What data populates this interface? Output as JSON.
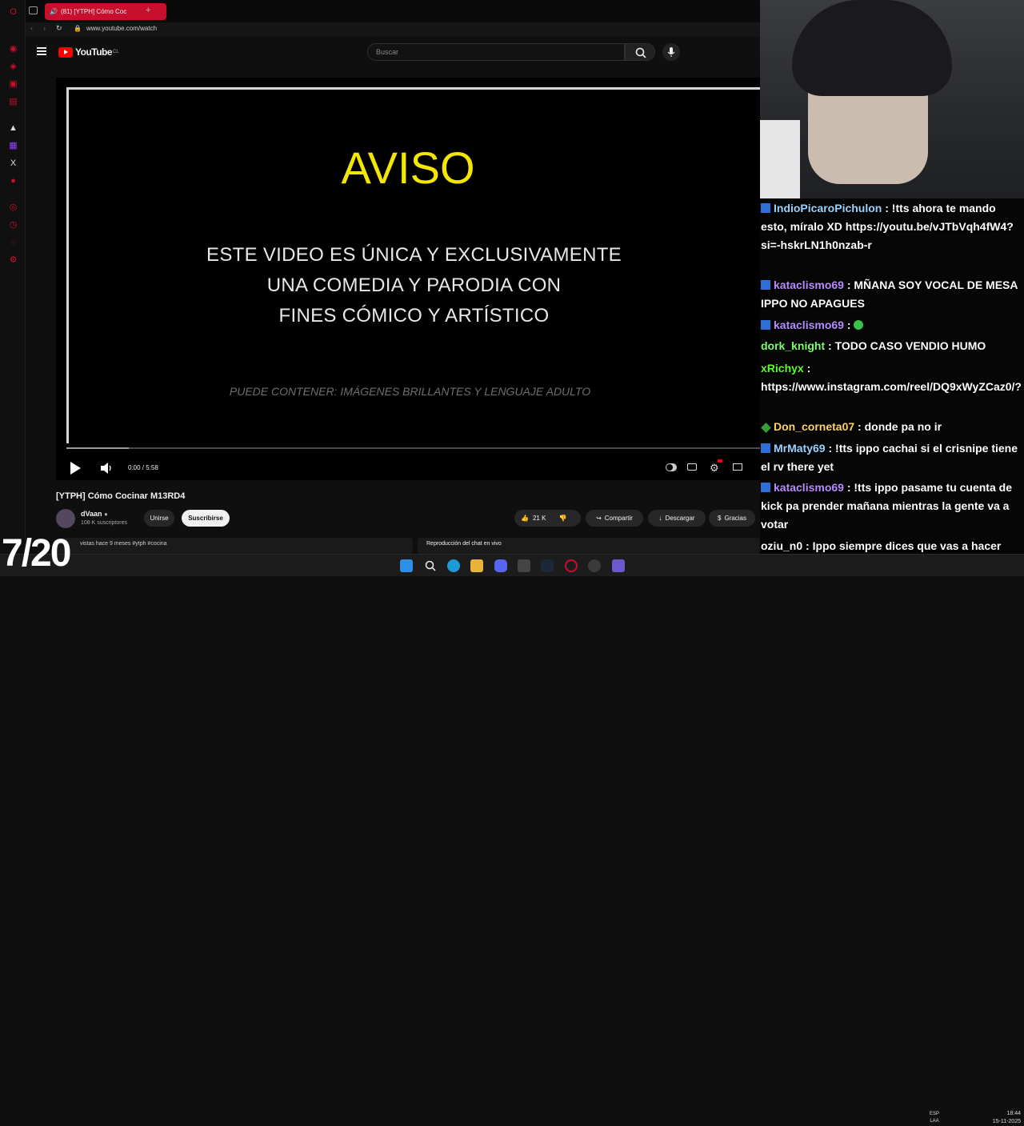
{
  "browser": {
    "tab_title": "(81) [YTPH] Cómo Coc",
    "url": "www.youtube.com/watch"
  },
  "youtube": {
    "logo_text": "YouTube",
    "logo_country": "CL",
    "search_placeholder": "Buscar"
  },
  "video": {
    "heading": "AVISO",
    "line1": "ESTE VIDEO ES ÚNICA Y EXCLUSIVAMENTE",
    "line2": "UNA COMEDIA Y PARODIA  CON",
    "line3": "FINES CÓMICO Y ARTÍSTICO",
    "subline": "PUEDE CONTENER: IMÁGENES BRILLANTES Y LENGUAJE ADULTO",
    "time": "0:00 / 5:58",
    "progress": 0.0
  },
  "meta": {
    "title": "[YTPH] Cómo Cocinar M13RD4",
    "channel": "dVaan",
    "subscribers": "108 K suscriptores",
    "join_label": "Unirse",
    "subscribe_label": "Suscribirse",
    "likes": "21 K",
    "share_label": "Compartir",
    "download_label": "Descargar",
    "thanks_label": "Gracias",
    "description": "vistas  hace 9 meses  #ytph #cocina",
    "chat_replay_label": "Reproducción del chat en vivo"
  },
  "chat": [
    {
      "user": "IndioPicaroPichulon",
      "color": "#9bd3ff",
      "text": " : !tts ahora te mando esto, míralo XD https://youtu.be/vJTbVqh4fW4?si=-hskrLN1h0nzab-r",
      "badge": "blue"
    },
    {
      "user": "kataclismo69",
      "color": "#b88cff",
      "text": " : MÑANA SOY VOCAL DE MESA IPPO NO APAGUES",
      "badge": "blue"
    },
    {
      "user": "kataclismo69",
      "color": "#b88cff",
      "text": " : ",
      "badge": "blue"
    },
    {
      "user": "dork_knight",
      "color": "#7dff6a",
      "text": " : TODO CASO VENDIO HUMO",
      "badge": ""
    },
    {
      "user": "xRichyx",
      "color": "#5cff2a",
      "text": " : https://www.instagram.com/reel/DQ9xWyZCaz0/?",
      "badge": ""
    },
    {
      "user": "Don_corneta07",
      "color": "#ffd36b",
      "text": " : donde pa no ir",
      "badge": "green"
    },
    {
      "user": "MrMaty69",
      "color": "#9bd3ff",
      "text": " : !tts ippo cachai si el crisnipe tiene el rv there yet",
      "badge": "blue"
    },
    {
      "user": "kataclismo69",
      "color": "#b88cff",
      "text": " : !tts ippo pasame tu cuenta de kick pa prender mañana mientras la gente va a votar",
      "badge": "blue"
    },
    {
      "user": "oziu_n0",
      "color": "#ffffff",
      "text": " : Ippo siempre dices que vas a hacer algo y no lo haces",
      "badge": ""
    }
  ],
  "overlay": {
    "counter": "7/20"
  },
  "taskbar": {
    "lang": "ESP\nLAA",
    "time": "18:44",
    "date": "15-11-2025"
  },
  "colors": {
    "youtube_red": "#ff0000",
    "opera_red": "#c8102e",
    "aviso_yellow": "#f3e600"
  }
}
